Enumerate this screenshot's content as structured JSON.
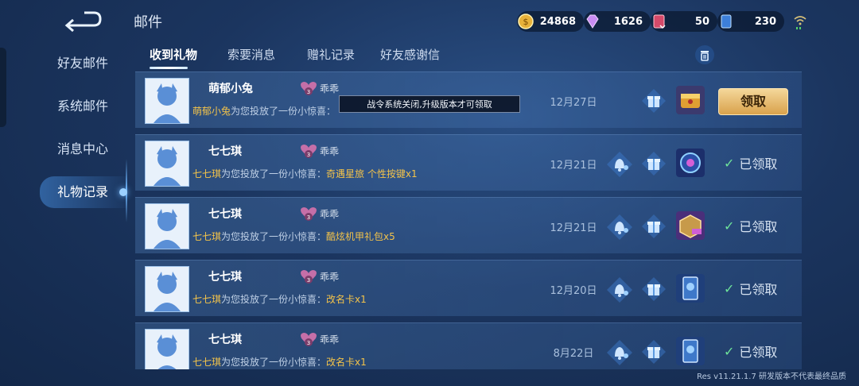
{
  "sidebar": {
    "items": [
      {
        "label": "好友邮件"
      },
      {
        "label": "系统邮件"
      },
      {
        "label": "消息中心"
      },
      {
        "label": "礼物记录"
      }
    ]
  },
  "header": {
    "title": "邮件"
  },
  "resources": [
    {
      "icon": "coin-icon",
      "value": "24868"
    },
    {
      "icon": "diamond-icon",
      "value": "1626"
    },
    {
      "icon": "voucher-icon",
      "value": "50"
    },
    {
      "icon": "card-icon",
      "value": "230"
    }
  ],
  "tabs": [
    {
      "label": "收到礼物"
    },
    {
      "label": "索要消息"
    },
    {
      "label": "赠礼记录"
    },
    {
      "label": "好友感谢信"
    }
  ],
  "gifts": [
    {
      "sender": "萌郁小兔",
      "level": "3",
      "nickname": "乖乖",
      "desc_mid": "为您投放了一份小惊喜：",
      "item": "",
      "date": "12月27日",
      "claim_label": "领取",
      "tooltip": "战令系统关闭,升级版本才可领取"
    },
    {
      "sender": "七七琪",
      "level": "3",
      "nickname": "乖乖",
      "desc_mid": "为您投放了一份小惊喜：",
      "item": "奇遇星旅 个性按键x1",
      "date": "12月21日",
      "claimed_label": "已领取"
    },
    {
      "sender": "七七琪",
      "level": "3",
      "nickname": "乖乖",
      "desc_mid": "为您投放了一份小惊喜：",
      "item": "酷炫机甲礼包x5",
      "date": "12月21日",
      "claimed_label": "已领取"
    },
    {
      "sender": "七七琪",
      "level": "3",
      "nickname": "乖乖",
      "desc_mid": "为您投放了一份小惊喜：",
      "item": "改名卡x1",
      "date": "12月20日",
      "claimed_label": "已领取"
    },
    {
      "sender": "七七琪",
      "level": "3",
      "nickname": "乖乖",
      "desc_mid": "为您投放了一份小惊喜：",
      "item": "改名卡x1",
      "date": "8月22日",
      "claimed_label": "已领取"
    }
  ],
  "footer": {
    "version": "Res v11.21.1.7 研发版本不代表最终品质"
  }
}
